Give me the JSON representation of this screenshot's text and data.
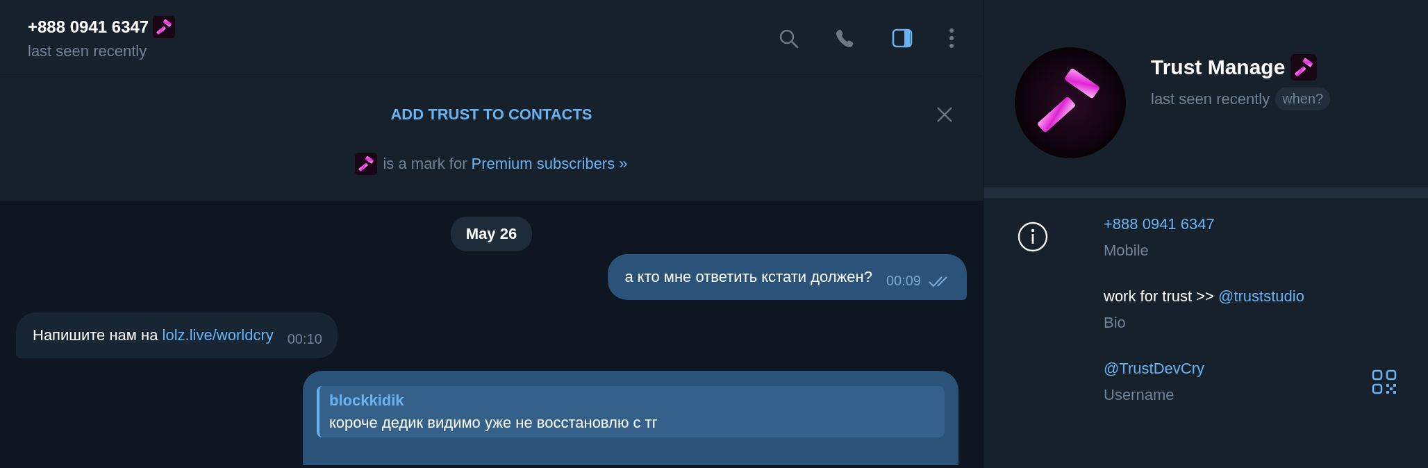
{
  "chat_header": {
    "title": "+888 0941 6347",
    "status": "last seen recently",
    "actions": [
      {
        "kind": "search",
        "selected": false
      },
      {
        "kind": "call",
        "selected": false
      },
      {
        "kind": "sidebar",
        "selected": true
      },
      {
        "kind": "more",
        "selected": false
      }
    ]
  },
  "contact_banner": {
    "action": "ADD TRUST TO CONTACTS",
    "note": "is a mark for ",
    "note_link": "Premium subscribers »"
  },
  "messages": [
    {
      "kind": "date",
      "text": "May 26"
    },
    {
      "kind": "outgoing",
      "text": "а кто мне ответить кстати должен?",
      "time": "00:09",
      "read": true
    },
    {
      "kind": "incoming",
      "text": "Напишите нам на ",
      "link": "lolz.live/worldcry",
      "time": "00:10"
    },
    {
      "kind": "outgoing",
      "reply": {
        "author": "blockkidik",
        "text": "короче дедик видимо уже не восстановлю с тг"
      }
    }
  ],
  "profile": {
    "name": "Trust Manage",
    "status": "last seen recently",
    "when_button": "when?",
    "info": [
      {
        "kind": "phone",
        "value": "+888 0941 6347",
        "label": "Mobile"
      },
      {
        "kind": "bio",
        "value": "work for trust >> ",
        "link": "@truststudio",
        "label": "Bio"
      },
      {
        "kind": "username",
        "value": "@TrustDevCry",
        "label": "Username"
      }
    ]
  }
}
